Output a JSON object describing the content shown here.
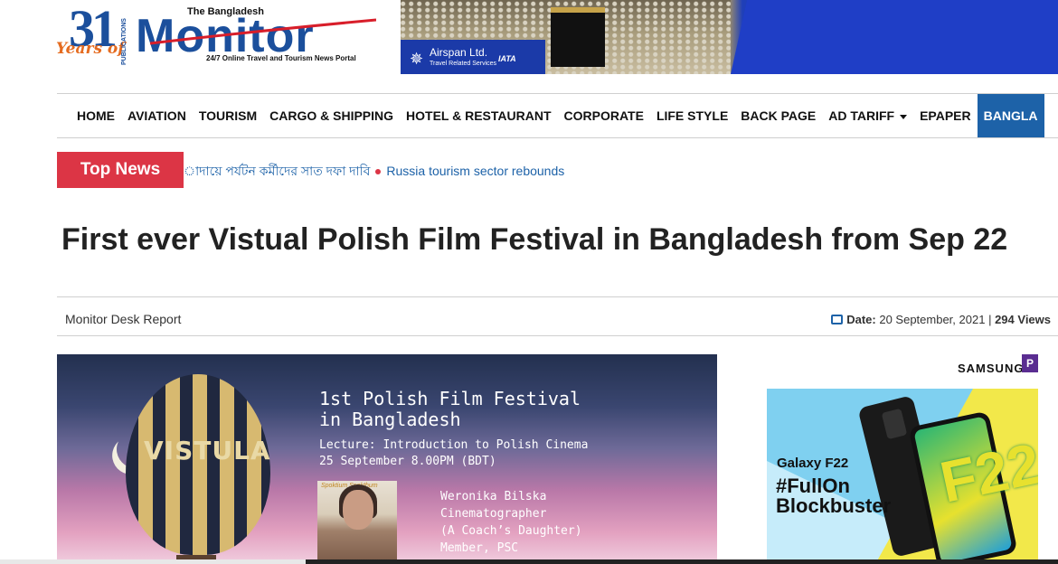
{
  "header": {
    "logo": {
      "number": "31",
      "years": "Years of",
      "publications": "PUBLICATIONS",
      "the": "The Bangladesh",
      "name": "Monitor",
      "tagline": "24/7 Online Travel and Tourism News Portal"
    },
    "banner": {
      "company": "Airspan Ltd.",
      "subtitle": "Travel Related Services",
      "iata": "IATA"
    }
  },
  "nav": {
    "items": [
      "HOME",
      "AVIATION",
      "TOURISM",
      "CARGO & SHIPPING",
      "HOTEL & RESTAURANT",
      "CORPORATE",
      "LIFE STYLE",
      "BACK PAGE",
      "AD TARIFF",
      "EPAPER",
      "BANGLA"
    ]
  },
  "top_news": {
    "label": "Top News",
    "ticker": [
      "াদায়ে পর্যটন কর্মীদের সাত দফা দাবি",
      "Russia tourism sector rebounds"
    ]
  },
  "article": {
    "headline": "First ever Vistual Polish Film Festival in Bangladesh from Sep 22",
    "author": "Monitor Desk Report",
    "date_label": "Date:",
    "date": "20 September, 2021",
    "separator": "|",
    "views": "294 Views"
  },
  "poster": {
    "balloon_label": "VISTULA",
    "title": "1st Polish Film Festival\nin Bangladesh",
    "lecture": "Lecture: Introduction to Polish Cinema\n25 September 8.00PM (BDT)",
    "photo_brand": "Spoktium Spokthum",
    "bio": "Weronika Bilska\nCinematographer\n(A Coach’s Daughter)\nMember, PSC\nPoland"
  },
  "ad": {
    "brand": "SAMSUNG",
    "badge": "P",
    "product": "Galaxy F22",
    "slogan": "#FullOn\nBlockbuster",
    "screen_text": "F22",
    "colors": {
      "sky": "#7fd0f0",
      "yellow": "#f2e84a"
    }
  },
  "colors": {
    "brand_blue": "#1b4f9c",
    "nav_active": "#1d62a8",
    "top_news": "#dc3545",
    "link": "#1d62a8"
  }
}
